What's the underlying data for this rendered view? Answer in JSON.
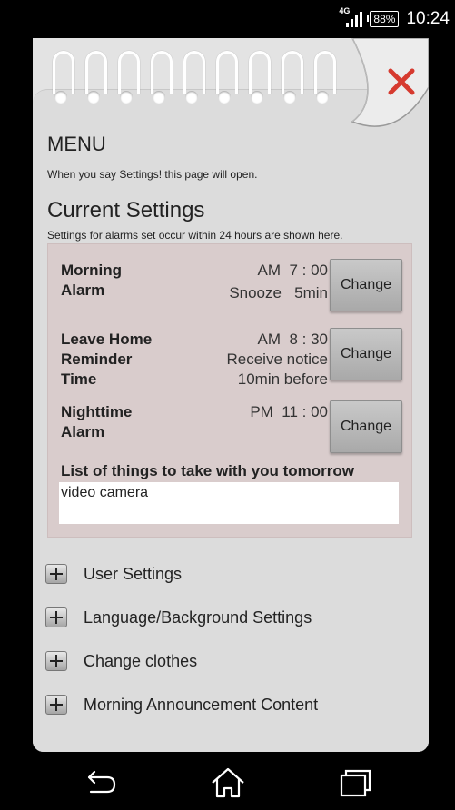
{
  "status_bar": {
    "network": "4G",
    "battery": "88%",
    "time": "10:24"
  },
  "page": {
    "menu_title": "MENU",
    "menu_description": "When you say Settings! this page will open.",
    "current_title": "Current Settings",
    "current_description": "Settings for alarms set occur within 24 hours are shown here."
  },
  "alarms": [
    {
      "label_lines": [
        "Morning",
        "Alarm"
      ],
      "value_lines": [
        "AM  7 : 00",
        "Snooze   5min"
      ],
      "button": "Change"
    },
    {
      "label_lines": [
        "Leave Home",
        "Reminder",
        "Time"
      ],
      "value_lines": [
        "AM  8 : 30",
        "Receive notice",
        "10min before"
      ],
      "button": "Change"
    },
    {
      "label_lines": [
        "Nighttime",
        "Alarm"
      ],
      "value_lines": [
        "PM  11 : 00"
      ],
      "button": "Change"
    }
  ],
  "take_list": {
    "label": "List of things to take with you tomorrow",
    "value": "video camera"
  },
  "menu_items": [
    "User Settings",
    "Language/Background Settings",
    "Change clothes",
    "Morning Announcement Content"
  ],
  "colors": {
    "close_x": "#d63a2f",
    "panel": "#d9cccc",
    "page": "#dcdcdc"
  },
  "icons": {
    "close": "close-x-icon",
    "expand": "plus-icon",
    "back": "back-icon",
    "home": "home-icon",
    "recents": "recents-icon"
  }
}
